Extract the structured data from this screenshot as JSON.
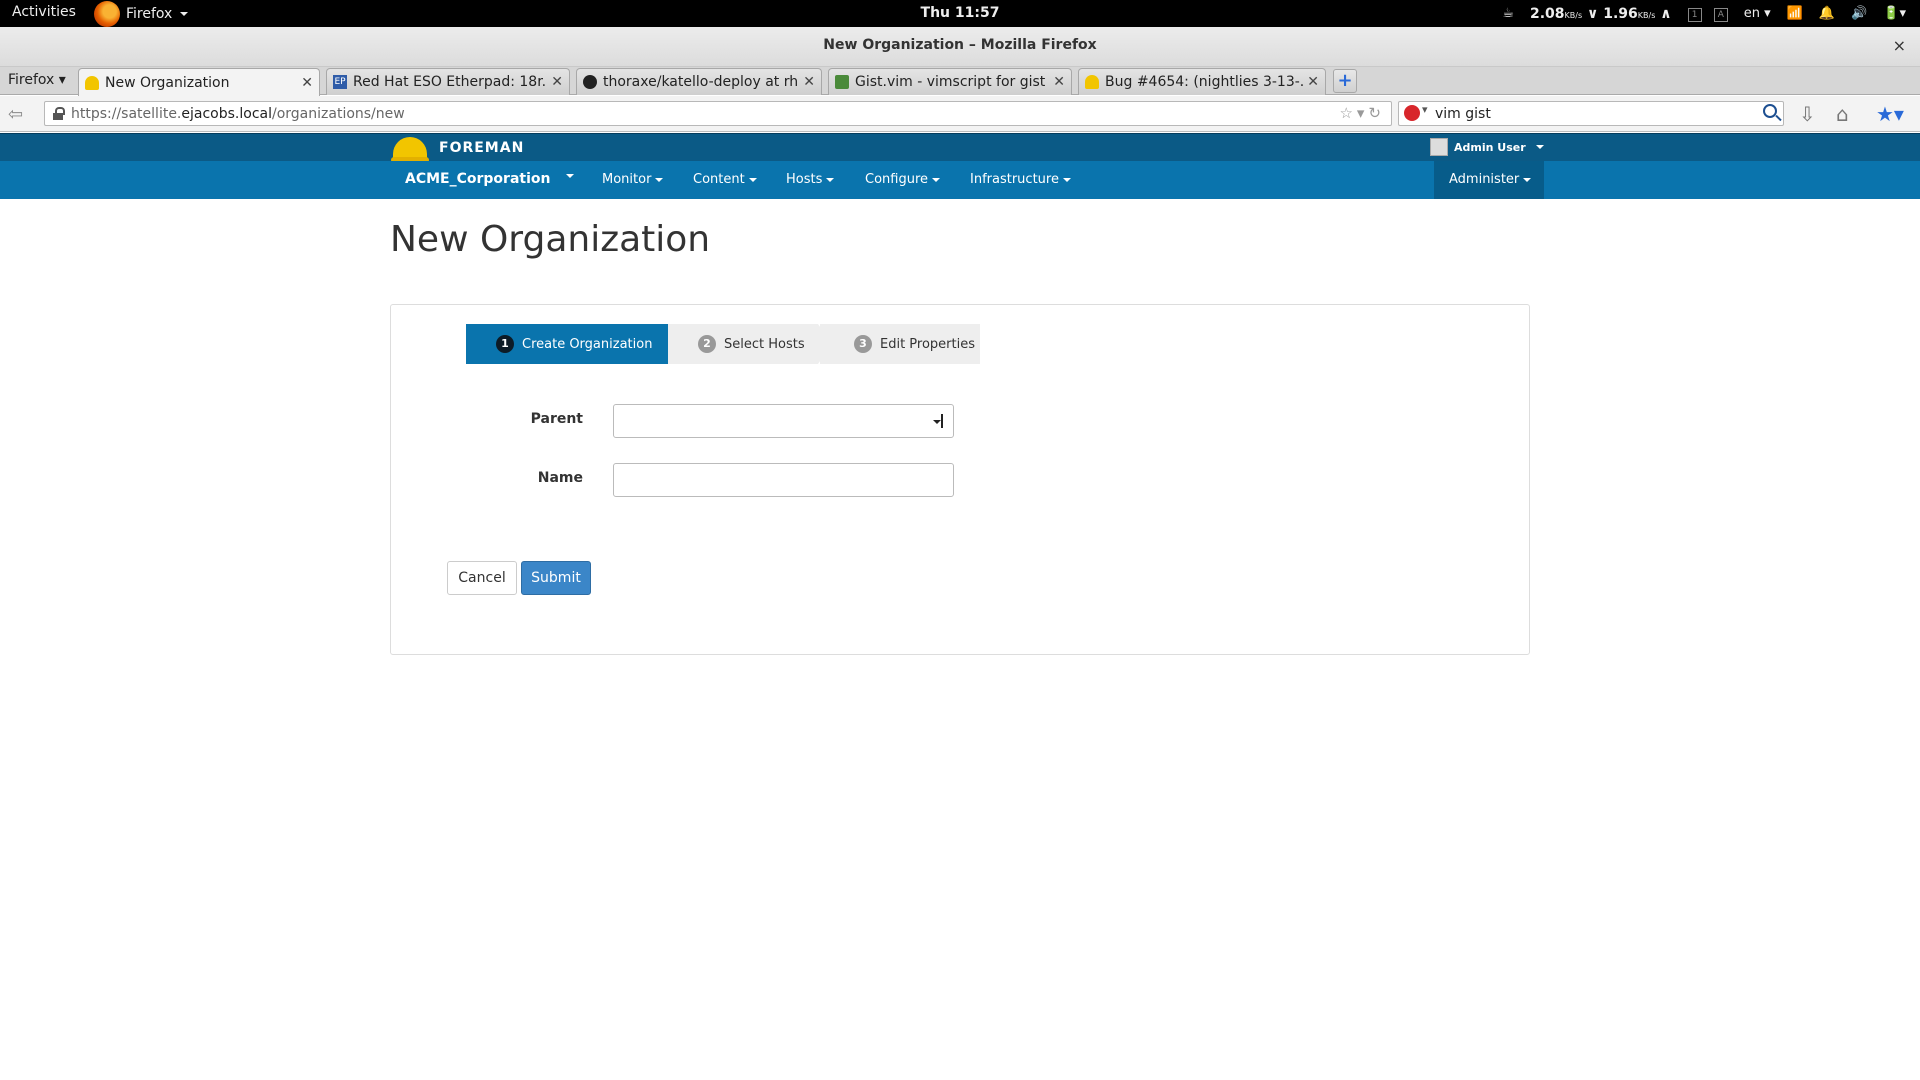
{
  "system_bar": {
    "activities": "Activities",
    "app_menu": "Firefox",
    "clock": "Thu 11:57",
    "net_down": "2.08",
    "net_down_unit": "KB/s",
    "net_up": "1.96",
    "net_up_unit": "KB/s",
    "ws1": "1",
    "ws2": "A",
    "lang": "en"
  },
  "window": {
    "title": "New Organization – Mozilla Firefox",
    "close": "×"
  },
  "browser": {
    "firefox_menu": "Firefox",
    "tabs": [
      {
        "label": "New Organization",
        "active": true
      },
      {
        "label": "Red Hat ESO Etherpad: 18r...",
        "active": false
      },
      {
        "label": "thoraxe/katello-deploy at rh...",
        "active": false
      },
      {
        "label": "Gist.vim - vimscript for gist : ...",
        "active": false
      },
      {
        "label": "Bug #4654: (nightlies 3-13-...",
        "active": false
      }
    ],
    "new_tab": "+",
    "url_prefix": "https://satellite.",
    "url_host": "ejacobs.local",
    "url_path": "/organizations/new",
    "search_value": "vim gist"
  },
  "foreman": {
    "brand": "FOREMAN",
    "user": "Admin User",
    "organization": "ACME_Corporation",
    "menu": [
      "Monitor",
      "Content",
      "Hosts",
      "Configure",
      "Infrastructure"
    ],
    "admin": "Administer"
  },
  "page": {
    "title": "New Organization",
    "steps": [
      {
        "num": "1",
        "label": "Create Organization",
        "active": true
      },
      {
        "num": "2",
        "label": "Select Hosts",
        "active": false
      },
      {
        "num": "3",
        "label": "Edit Properties",
        "active": false
      }
    ],
    "form": {
      "parent_label": "Parent",
      "parent_value": "",
      "name_label": "Name",
      "name_value": ""
    },
    "buttons": {
      "cancel": "Cancel",
      "submit": "Submit"
    }
  },
  "colors": {
    "foreman_top": "#0b5a86",
    "foreman_nav": "#0a74ad",
    "active_step": "#0a74ad",
    "submit": "#3b86c8"
  }
}
